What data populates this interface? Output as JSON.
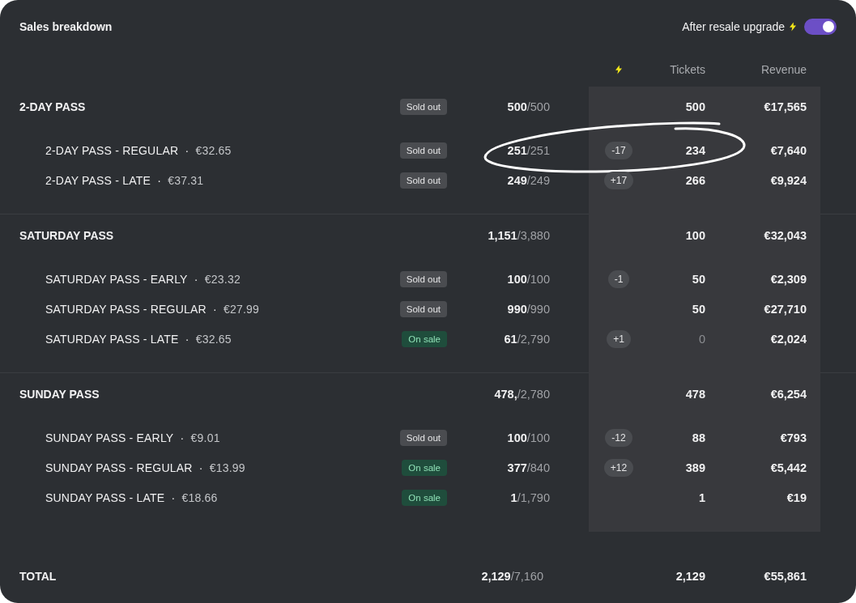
{
  "title": "Sales breakdown",
  "toggle": {
    "label": "After resale upgrade",
    "on": true
  },
  "columns": {
    "tickets": "Tickets",
    "revenue": "Revenue"
  },
  "sections": [
    {
      "name": "2-DAY PASS",
      "status": {
        "label": "Sold out",
        "kind": "sold_out"
      },
      "sold": "500",
      "capacity": "/500",
      "tickets": "500",
      "revenue": "€17,565",
      "rows": [
        {
          "name": "2-DAY PASS - REGULAR",
          "separator": "·",
          "price": "€32.65",
          "status": {
            "label": "Sold out",
            "kind": "sold_out"
          },
          "sold": "251",
          "capacity": "/251",
          "delta": "-17",
          "tickets": "234",
          "tickets_dimmed": false,
          "revenue": "€7,640"
        },
        {
          "name": "2-DAY PASS - LATE",
          "separator": "·",
          "price": "€37.31",
          "status": {
            "label": "Sold out",
            "kind": "sold_out"
          },
          "sold": "249",
          "capacity": "/249",
          "delta": "+17",
          "tickets": "266",
          "tickets_dimmed": false,
          "revenue": "€9,924"
        }
      ]
    },
    {
      "name": "SATURDAY PASS",
      "sold": "1,151",
      "capacity": "/3,880",
      "tickets": "100",
      "revenue": "€32,043",
      "rows": [
        {
          "name": "SATURDAY PASS - EARLY",
          "separator": "·",
          "price": "€23.32",
          "status": {
            "label": "Sold out",
            "kind": "sold_out"
          },
          "sold": "100",
          "capacity": "/100",
          "delta": "-1",
          "tickets": "50",
          "tickets_dimmed": false,
          "revenue": "€2,309"
        },
        {
          "name": "SATURDAY PASS - REGULAR",
          "separator": "·",
          "price": "€27.99",
          "status": {
            "label": "Sold out",
            "kind": "sold_out"
          },
          "sold": "990",
          "capacity": "/990",
          "tickets": "50",
          "tickets_dimmed": false,
          "revenue": "€27,710"
        },
        {
          "name": "SATURDAY PASS - LATE",
          "separator": "·",
          "price": "€32.65",
          "status": {
            "label": "On sale",
            "kind": "on_sale"
          },
          "sold": "61",
          "capacity": "/2,790",
          "delta": "+1",
          "tickets": "0",
          "tickets_dimmed": true,
          "revenue": "€2,024"
        }
      ]
    },
    {
      "name": "SUNDAY PASS",
      "sold": "478,",
      "capacity": "/2,780",
      "tickets": "478",
      "revenue": "€6,254",
      "rows": [
        {
          "name": "SUNDAY PASS - EARLY",
          "separator": "·",
          "price": "€9.01",
          "status": {
            "label": "Sold out",
            "kind": "sold_out"
          },
          "sold": "100",
          "capacity": "/100",
          "delta": "-12",
          "tickets": "88",
          "tickets_dimmed": false,
          "revenue": "€793"
        },
        {
          "name": "SUNDAY PASS - REGULAR",
          "separator": "·",
          "price": "€13.99",
          "status": {
            "label": "On sale",
            "kind": "on_sale"
          },
          "sold": "377",
          "capacity": "/840",
          "delta": "+12",
          "tickets": "389",
          "tickets_dimmed": false,
          "revenue": "€5,442"
        },
        {
          "name": "SUNDAY PASS - LATE",
          "separator": "·",
          "price": "€18.66",
          "status": {
            "label": "On sale",
            "kind": "on_sale"
          },
          "sold": "1",
          "capacity": "/1,790",
          "tickets": "1",
          "tickets_dimmed": false,
          "revenue": "€19"
        }
      ]
    }
  ],
  "total": {
    "label": "TOTAL",
    "sold": "2,129",
    "capacity": "/7,160",
    "tickets": "2,129",
    "revenue": "€55,861"
  }
}
